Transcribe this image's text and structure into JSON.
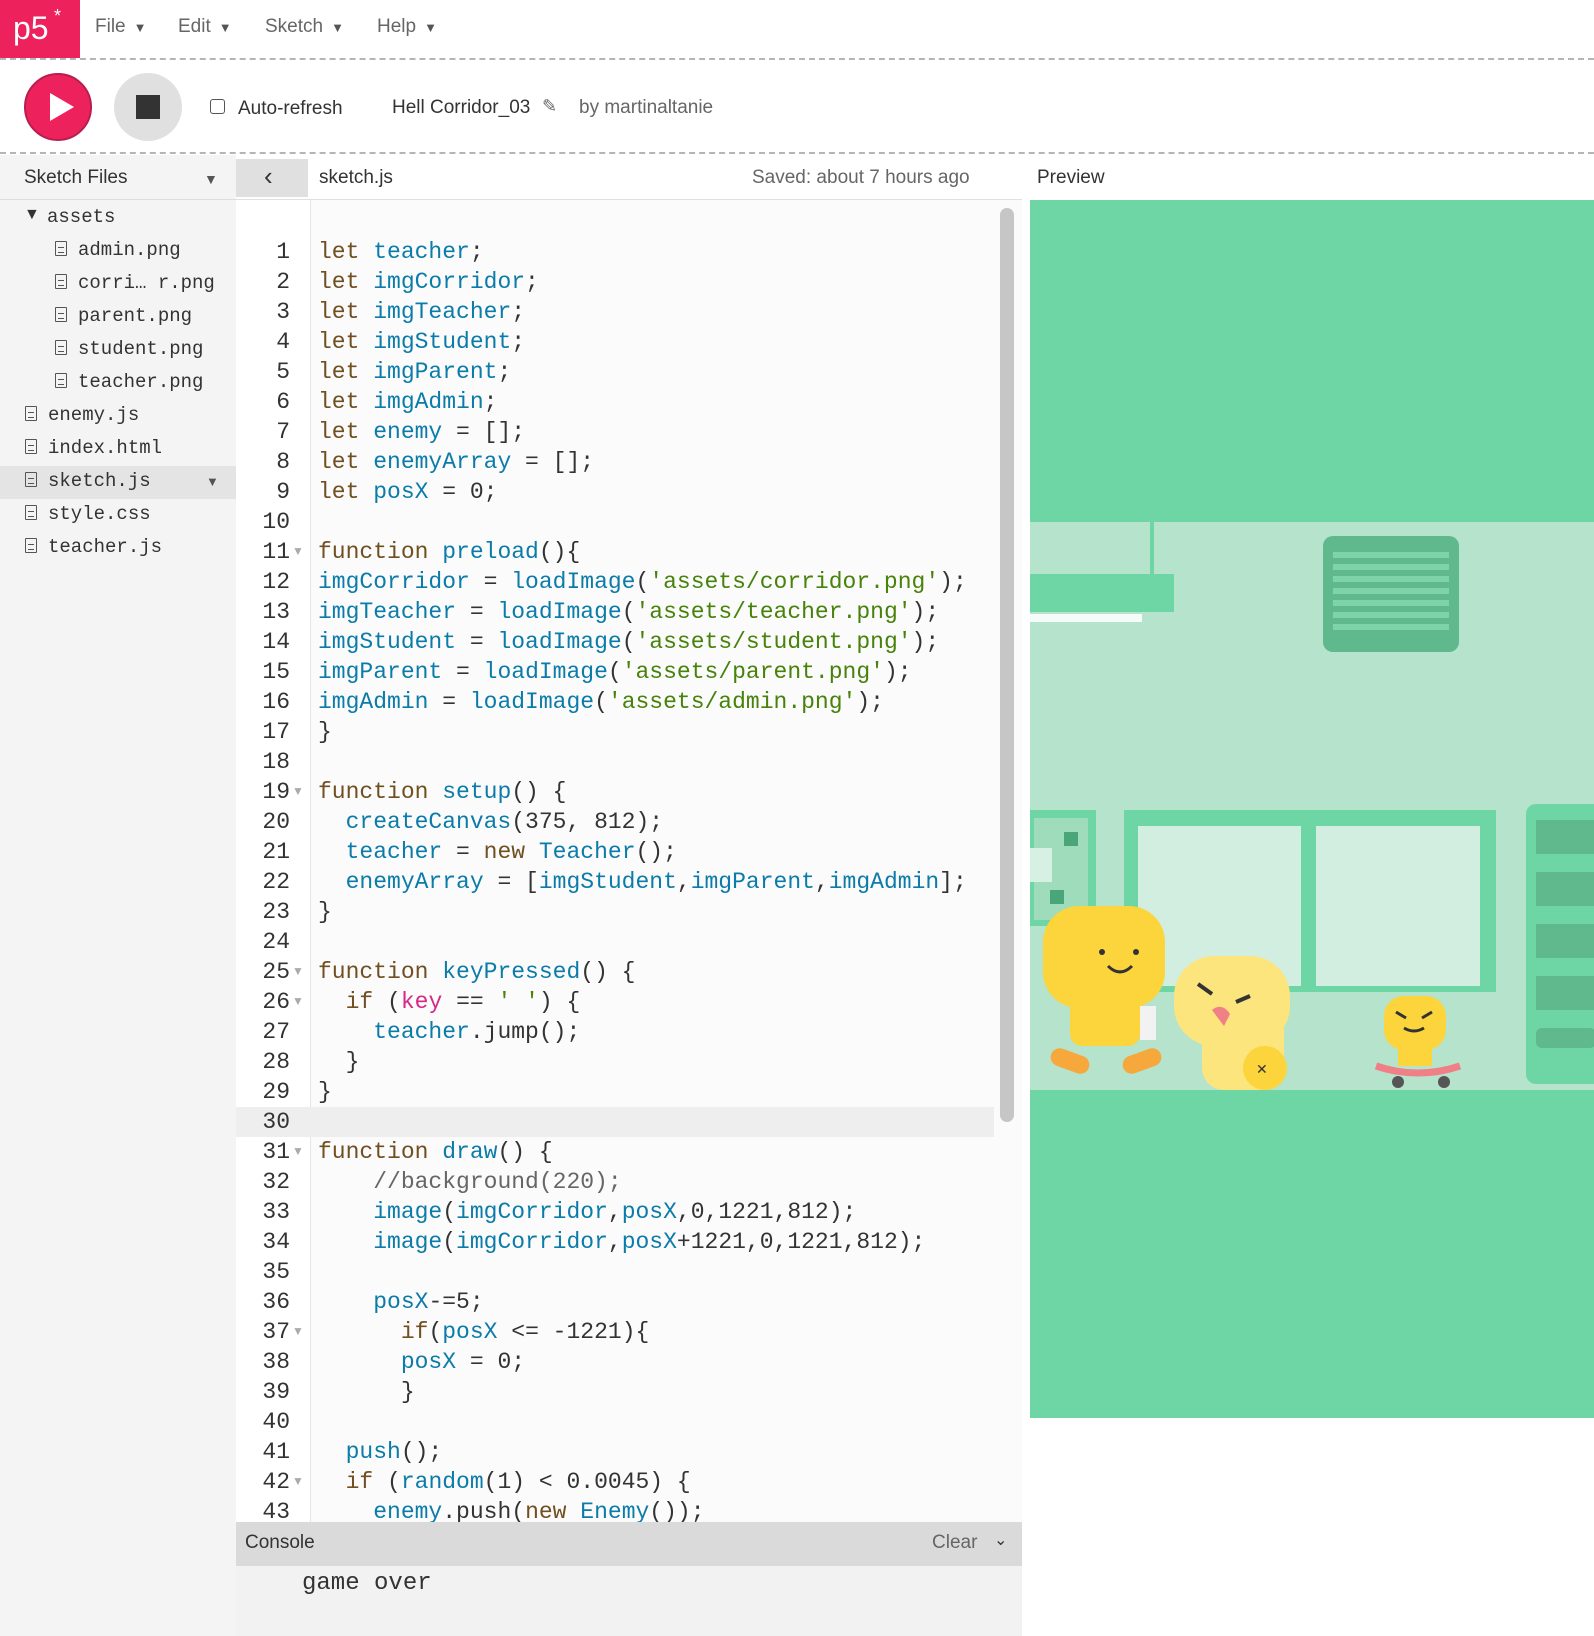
{
  "app": {
    "logo_text": "p5",
    "logo_star": "*"
  },
  "menu": {
    "items": [
      {
        "label": "File"
      },
      {
        "label": "Edit"
      },
      {
        "label": "Sketch"
      },
      {
        "label": "Help"
      }
    ]
  },
  "toolbar": {
    "auto_refresh_label": "Auto-refresh",
    "auto_refresh_checked": false,
    "sketch_title": "Hell Corridor_03",
    "byline": "by martinaltanie"
  },
  "sidebar": {
    "header": "Sketch Files",
    "folder": "assets",
    "folder_files": [
      "admin.png",
      "corri… r.png",
      "parent.png",
      "student.png",
      "teacher.png"
    ],
    "files": [
      "enemy.js",
      "index.html",
      "sketch.js",
      "style.css",
      "teacher.js"
    ],
    "selected_file": "sketch.js"
  },
  "editor": {
    "tab_name": "sketch.js",
    "saved_status": "Saved: about 7 hours ago",
    "active_line": 30,
    "fold_lines": [
      11,
      19,
      25,
      26,
      31,
      37,
      42
    ]
  },
  "code_lines": [
    [
      [
        "k",
        "let "
      ],
      [
        "v",
        "teacher"
      ],
      [
        "p",
        ";"
      ]
    ],
    [
      [
        "k",
        "let "
      ],
      [
        "v",
        "imgCorridor"
      ],
      [
        "p",
        ";"
      ]
    ],
    [
      [
        "k",
        "let "
      ],
      [
        "v",
        "imgTeacher"
      ],
      [
        "p",
        ";"
      ]
    ],
    [
      [
        "k",
        "let "
      ],
      [
        "v",
        "imgStudent"
      ],
      [
        "p",
        ";"
      ]
    ],
    [
      [
        "k",
        "let "
      ],
      [
        "v",
        "imgParent"
      ],
      [
        "p",
        ";"
      ]
    ],
    [
      [
        "k",
        "let "
      ],
      [
        "v",
        "imgAdmin"
      ],
      [
        "p",
        ";"
      ]
    ],
    [
      [
        "k",
        "let "
      ],
      [
        "v",
        "enemy"
      ],
      [
        "p",
        " = [];"
      ]
    ],
    [
      [
        "k",
        "let "
      ],
      [
        "v",
        "enemyArray"
      ],
      [
        "p",
        " = [];"
      ]
    ],
    [
      [
        "k",
        "let "
      ],
      [
        "v",
        "posX"
      ],
      [
        "p",
        " = 0;"
      ]
    ],
    [],
    [
      [
        "k",
        "function "
      ],
      [
        "v",
        "preload"
      ],
      [
        "p",
        "(){"
      ]
    ],
    [
      [
        "v",
        "imgCorridor"
      ],
      [
        "p",
        " = "
      ],
      [
        "v",
        "loadImage"
      ],
      [
        "p",
        "("
      ],
      [
        "s",
        "'assets/corridor.png'"
      ],
      [
        "p",
        ");"
      ]
    ],
    [
      [
        "v",
        "imgTeacher"
      ],
      [
        "p",
        " = "
      ],
      [
        "v",
        "loadImage"
      ],
      [
        "p",
        "("
      ],
      [
        "s",
        "'assets/teacher.png'"
      ],
      [
        "p",
        ");"
      ]
    ],
    [
      [
        "v",
        "imgStudent"
      ],
      [
        "p",
        " = "
      ],
      [
        "v",
        "loadImage"
      ],
      [
        "p",
        "("
      ],
      [
        "s",
        "'assets/student.png'"
      ],
      [
        "p",
        ");"
      ]
    ],
    [
      [
        "v",
        "imgParent"
      ],
      [
        "p",
        " = "
      ],
      [
        "v",
        "loadImage"
      ],
      [
        "p",
        "("
      ],
      [
        "s",
        "'assets/parent.png'"
      ],
      [
        "p",
        ");"
      ]
    ],
    [
      [
        "v",
        "imgAdmin"
      ],
      [
        "p",
        " = "
      ],
      [
        "v",
        "loadImage"
      ],
      [
        "p",
        "("
      ],
      [
        "s",
        "'assets/admin.png'"
      ],
      [
        "p",
        ");"
      ]
    ],
    [
      [
        "p",
        "}"
      ]
    ],
    [],
    [
      [
        "k",
        "function "
      ],
      [
        "v",
        "setup"
      ],
      [
        "p",
        "() {"
      ]
    ],
    [
      [
        "p",
        "  "
      ],
      [
        "v",
        "createCanvas"
      ],
      [
        "p",
        "(375, 812);"
      ]
    ],
    [
      [
        "p",
        "  "
      ],
      [
        "v",
        "teacher"
      ],
      [
        "p",
        " = "
      ],
      [
        "k",
        "new "
      ],
      [
        "v",
        "Teacher"
      ],
      [
        "p",
        "();"
      ]
    ],
    [
      [
        "p",
        "  "
      ],
      [
        "v",
        "enemyArray"
      ],
      [
        "p",
        " = ["
      ],
      [
        "v",
        "imgStudent"
      ],
      [
        "p",
        ","
      ],
      [
        "v",
        "imgParent"
      ],
      [
        "p",
        ","
      ],
      [
        "v",
        "imgAdmin"
      ],
      [
        "p",
        "];"
      ]
    ],
    [
      [
        "p",
        "}"
      ]
    ],
    [],
    [
      [
        "k",
        "function "
      ],
      [
        "v",
        "keyPressed"
      ],
      [
        "p",
        "() {"
      ]
    ],
    [
      [
        "p",
        "  "
      ],
      [
        "k",
        "if "
      ],
      [
        "p",
        "("
      ],
      [
        "m",
        "key"
      ],
      [
        "p",
        " == "
      ],
      [
        "s",
        "' '"
      ],
      [
        "p",
        ") {"
      ]
    ],
    [
      [
        "p",
        "    "
      ],
      [
        "v",
        "teacher"
      ],
      [
        "p",
        ".jump();"
      ]
    ],
    [
      [
        "p",
        "  }"
      ]
    ],
    [
      [
        "p",
        "}"
      ]
    ],
    [],
    [
      [
        "k",
        "function "
      ],
      [
        "v",
        "draw"
      ],
      [
        "p",
        "() {"
      ]
    ],
    [
      [
        "p",
        "    "
      ],
      [
        "c",
        "//background(220);"
      ]
    ],
    [
      [
        "p",
        "    "
      ],
      [
        "v",
        "image"
      ],
      [
        "p",
        "("
      ],
      [
        "v",
        "imgCorridor"
      ],
      [
        "p",
        ","
      ],
      [
        "v",
        "posX"
      ],
      [
        "p",
        ",0,1221,812);"
      ]
    ],
    [
      [
        "p",
        "    "
      ],
      [
        "v",
        "image"
      ],
      [
        "p",
        "("
      ],
      [
        "v",
        "imgCorridor"
      ],
      [
        "p",
        ","
      ],
      [
        "v",
        "posX"
      ],
      [
        "p",
        "+1221,0,1221,812);"
      ]
    ],
    [],
    [
      [
        "p",
        "    "
      ],
      [
        "v",
        "posX"
      ],
      [
        "p",
        "-=5;"
      ]
    ],
    [
      [
        "p",
        "      "
      ],
      [
        "k",
        "if"
      ],
      [
        "p",
        "("
      ],
      [
        "v",
        "posX"
      ],
      [
        "p",
        " <= -1221){"
      ]
    ],
    [
      [
        "p",
        "      "
      ],
      [
        "v",
        "posX"
      ],
      [
        "p",
        " = 0;"
      ]
    ],
    [
      [
        "p",
        "      }"
      ]
    ],
    [],
    [
      [
        "p",
        "  "
      ],
      [
        "v",
        "push"
      ],
      [
        "p",
        "();"
      ]
    ],
    [
      [
        "p",
        "  "
      ],
      [
        "k",
        "if "
      ],
      [
        "p",
        "("
      ],
      [
        "v",
        "random"
      ],
      [
        "p",
        "(1) < 0.0045) {"
      ]
    ],
    [
      [
        "p",
        "    "
      ],
      [
        "v",
        "enemy"
      ],
      [
        "p",
        ".push("
      ],
      [
        "k",
        "new "
      ],
      [
        "v",
        "Enemy"
      ],
      [
        "p",
        "());"
      ]
    ]
  ],
  "console": {
    "title": "Console",
    "clear_label": "Clear",
    "lines": [
      "game over"
    ]
  },
  "preview": {
    "label": "Preview",
    "colors": {
      "floor": "#6ed5a4",
      "wall": "#b6e3cc",
      "trim": "#6ed5a4",
      "character": "#fcd43c"
    }
  },
  "colors": {
    "brand": "#ed225d",
    "keyword": "#704f21",
    "variable": "#0b7ca9",
    "string": "#47820a",
    "special": "#d52889"
  }
}
